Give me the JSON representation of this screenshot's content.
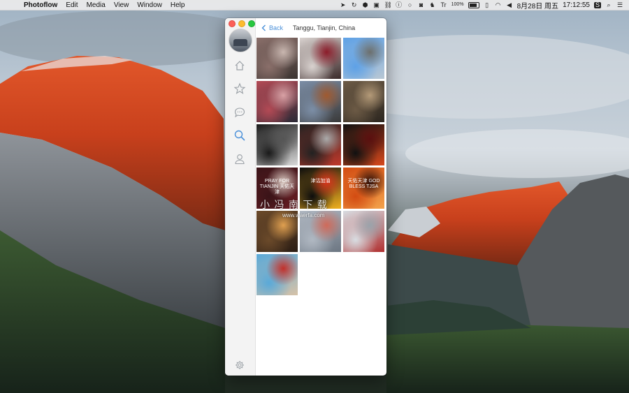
{
  "menubar": {
    "apple_glyph": "",
    "items": [
      "Photoflow",
      "Edit",
      "Media",
      "View",
      "Window",
      "Help"
    ],
    "battery_percent_label": "100%",
    "text_icon_label": "Tr",
    "date": "8月28日 周五",
    "time": "17:12:55"
  },
  "app": {
    "back_label": "Back",
    "location_title": "Tanggu, Tianjin, China",
    "nav_items": [
      "home-icon",
      "star-icon",
      "chat-icon",
      "search-icon",
      "profile-icon"
    ],
    "active_nav": "search-icon",
    "photos": [
      {
        "caption": "",
        "colors": [
          "#8a6f6a",
          "#3b3431",
          "#c9b7b0"
        ]
      },
      {
        "caption": "",
        "colors": [
          "#d9d2cf",
          "#3b2a2a",
          "#8c1c2a"
        ]
      },
      {
        "caption": "",
        "colors": [
          "#5ea1e6",
          "#b8c7d4",
          "#6c6f6d"
        ]
      },
      {
        "caption": "",
        "colors": [
          "#b34a55",
          "#2b2a36",
          "#d8a1a5"
        ]
      },
      {
        "caption": "",
        "colors": [
          "#7c8ea6",
          "#3a3a3a",
          "#a05a30"
        ]
      },
      {
        "caption": "",
        "colors": [
          "#6c5a45",
          "#2d2720",
          "#b49a78"
        ]
      },
      {
        "caption": "",
        "colors": [
          "#1a1a1a",
          "#d9d9d9",
          "#555555"
        ]
      },
      {
        "caption": "",
        "colors": [
          "#222222",
          "#c0392b",
          "#aaaaaa"
        ]
      },
      {
        "caption": "",
        "colors": [
          "#111111",
          "#d8481c",
          "#5a0f0f"
        ]
      },
      {
        "caption": "PRAY FOR TIANJIN 天佑天津",
        "colors": [
          "#3a1418",
          "#6b1e24",
          "#d8c8c0"
        ]
      },
      {
        "caption": "津沽加油",
        "colors": [
          "#0d0d0d",
          "#f0b020",
          "#d8341c"
        ]
      },
      {
        "caption": "天佑天津 GOD BLESS TJSA",
        "colors": [
          "#d34c12",
          "#f3a24b",
          "#2a0c06"
        ]
      },
      {
        "caption": "",
        "colors": [
          "#6b4a2a",
          "#2b1d14",
          "#e0a050"
        ]
      },
      {
        "caption": "",
        "colors": [
          "#b0b8c2",
          "#6c7682",
          "#d06a5a"
        ]
      },
      {
        "caption": "",
        "colors": [
          "#d8dde2",
          "#b03030",
          "#9aa3ab"
        ]
      },
      {
        "caption": "",
        "colors": [
          "#5aa9d8",
          "#d6c2a8",
          "#c2302a"
        ]
      }
    ]
  },
  "watermark": {
    "cn_text": "小 冯 南  下 载",
    "url": "www.waerfa.com"
  }
}
